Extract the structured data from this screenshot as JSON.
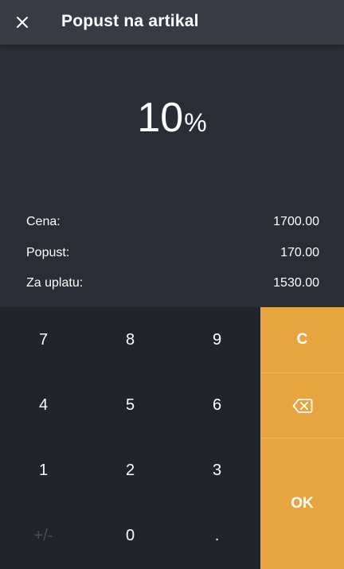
{
  "header": {
    "title": "Popust na artikal",
    "close_icon": "close-icon"
  },
  "display": {
    "value": "10",
    "unit": "%"
  },
  "summary": {
    "price_label": "Cena:",
    "price_value": "1700.00",
    "discount_label": "Popust:",
    "discount_value": "170.00",
    "total_label": "Za uplatu:",
    "total_value": "1530.00"
  },
  "keypad": {
    "keys": [
      "7",
      "8",
      "9",
      "4",
      "5",
      "6",
      "1",
      "2",
      "3",
      "+/-",
      "0",
      "."
    ]
  },
  "side": {
    "clear_label": "C",
    "backspace_icon": "backspace-icon",
    "ok_label": "OK"
  },
  "colors": {
    "background": "#2a2d35",
    "header": "#383b44",
    "keypad": "#21242b",
    "accent": "#e8a43e"
  }
}
